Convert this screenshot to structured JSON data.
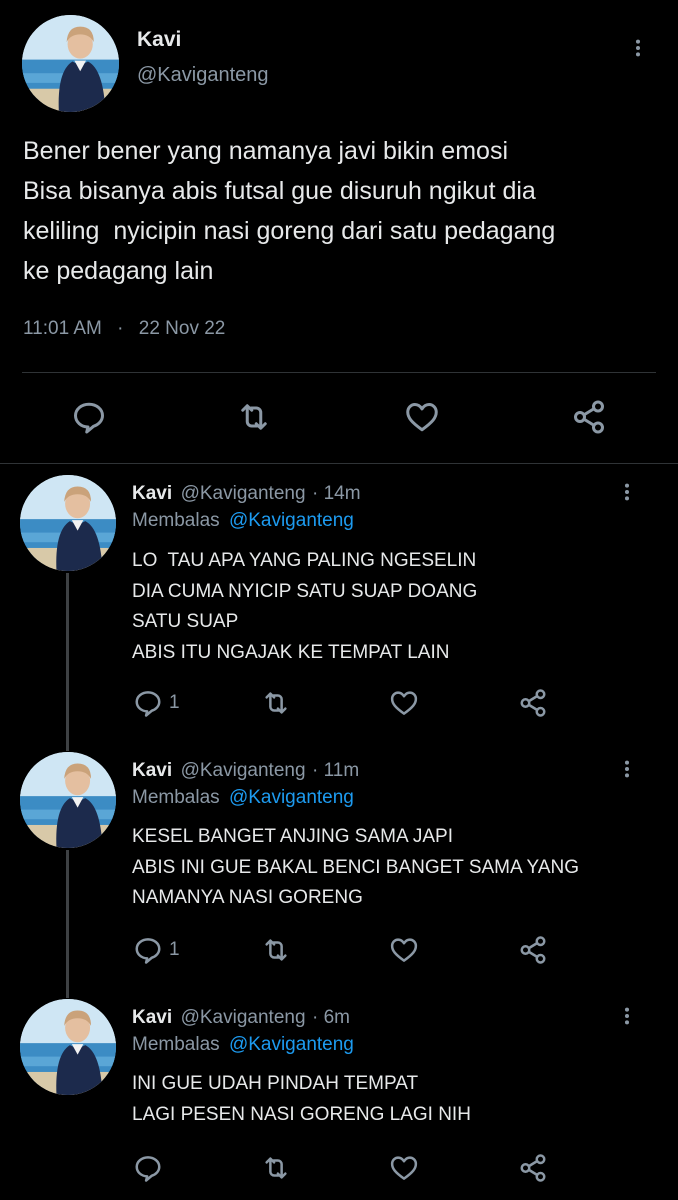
{
  "main_tweet": {
    "author_name": "Kavi",
    "author_handle": "@Kaviganteng",
    "text_lines": [
      "Bener bener yang namanya javi bikin emosi",
      "Bisa bisanya abis futsal gue disuruh ngikut dia",
      "keliling  nyicipin nasi goreng dari satu pedagang",
      "ke pedagang lain"
    ],
    "time": "11:01 AM",
    "separator": "·",
    "date": "22 Nov 22"
  },
  "replies": [
    {
      "author_name": "Kavi",
      "author_handle": "@Kaviganteng",
      "age": "· 14m",
      "replying_label": "Membalas",
      "replying_to": "@Kaviganteng",
      "text_lines": [
        "LO  TAU APA YANG PALING NGESELIN",
        "DIA CUMA NYICIP SATU SUAP DOANG",
        "SATU SUAP",
        "ABIS ITU NGAJAK KE TEMPAT LAIN"
      ],
      "reply_count": "1"
    },
    {
      "author_name": "Kavi",
      "author_handle": "@Kaviganteng",
      "age": "· 11m",
      "replying_label": "Membalas",
      "replying_to": "@Kaviganteng",
      "text_lines": [
        "KESEL BANGET ANJING SAMA JAPI",
        "ABIS INI GUE BAKAL BENCI BANGET SAMA YANG",
        "NAMANYA NASI GORENG"
      ],
      "reply_count": "1"
    },
    {
      "author_name": "Kavi",
      "author_handle": "@Kaviganteng",
      "age": "· 6m",
      "replying_label": "Membalas",
      "replying_to": "@Kaviganteng",
      "text_lines": [
        "INI GUE UDAH PINDAH TEMPAT",
        "LAGI PESEN NASI GORENG LAGI NIH"
      ],
      "reply_count": ""
    }
  ],
  "icons": {
    "more": "more-vertical-icon",
    "reply": "reply-icon",
    "retweet": "retweet-icon",
    "like": "heart-icon",
    "share": "share-icon"
  },
  "colors": {
    "background": "#000000",
    "text": "#e7e9ea",
    "secondary": "#8b98a5",
    "link": "#1d9bf0",
    "divider": "#2f3336"
  }
}
